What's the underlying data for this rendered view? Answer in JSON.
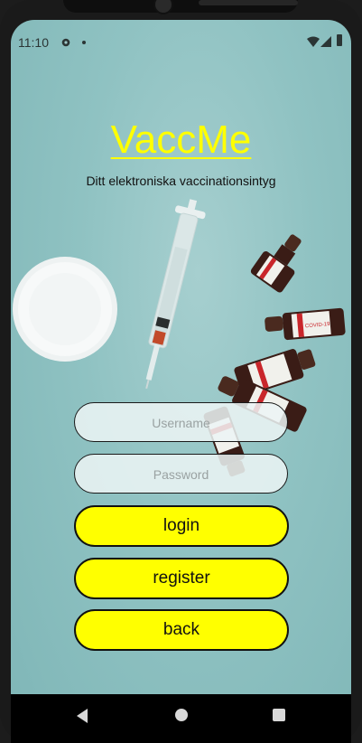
{
  "status_bar": {
    "time": "11:10",
    "icons": [
      "gear-icon",
      "dot-icon",
      "wifi-icon",
      "signal-icon",
      "battery-icon"
    ]
  },
  "app": {
    "title": "VaccMe",
    "subtitle": "Ditt elektroniska vaccinationsintyg",
    "title_color": "#ffff00",
    "button_color": "#ffff00"
  },
  "form": {
    "username_placeholder": "Username",
    "password_placeholder": "Password"
  },
  "buttons": {
    "login": "login",
    "register": "register",
    "back": "back"
  },
  "vial_label": "COVID-19",
  "nav_bar": {
    "icons": [
      "back-triangle-icon",
      "home-circle-icon",
      "recents-square-icon"
    ]
  }
}
